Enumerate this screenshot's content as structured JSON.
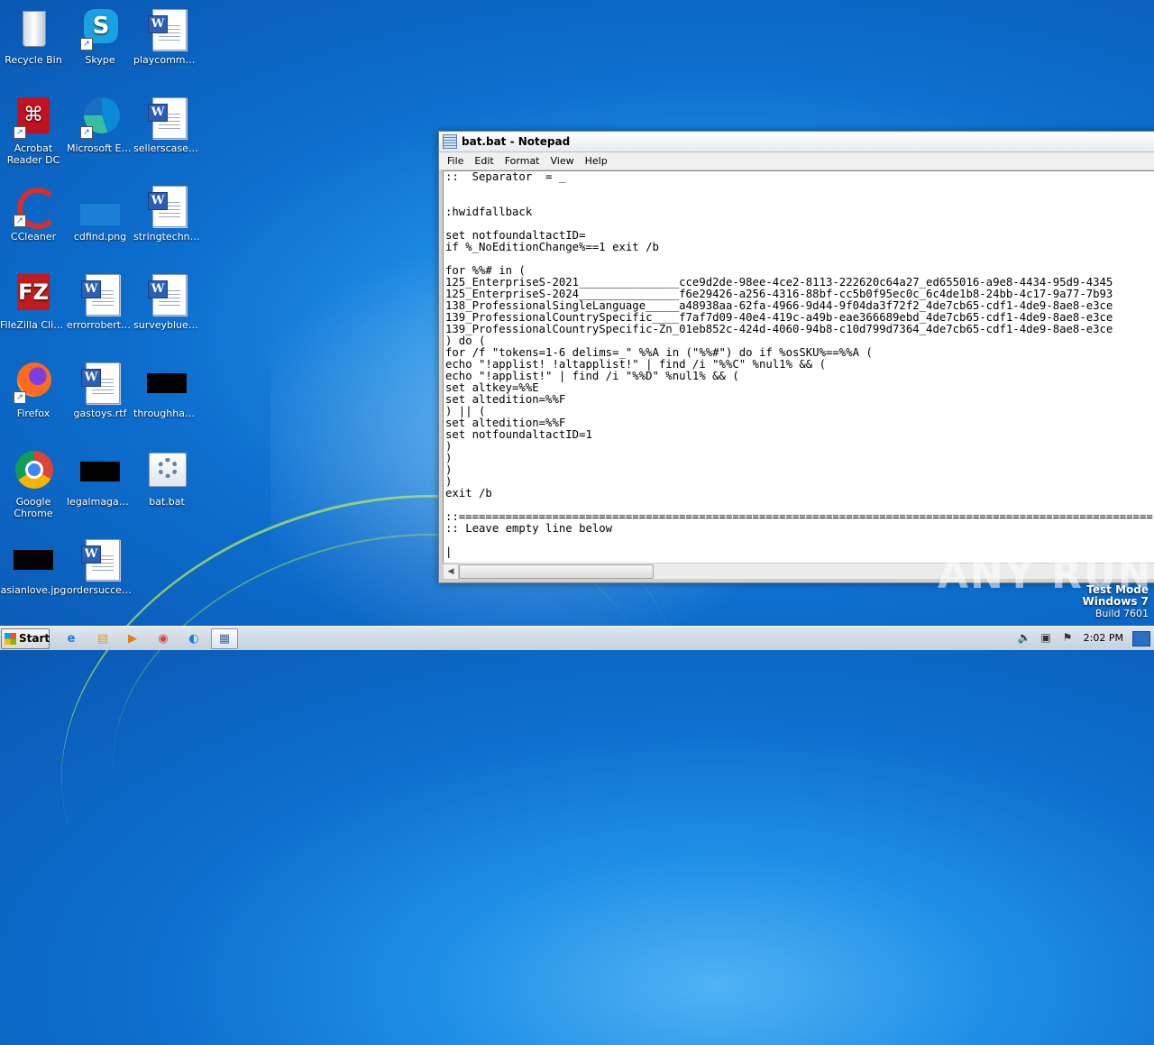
{
  "desktop": {
    "icons": [
      {
        "label": "Recycle Bin",
        "icon": "recycle-bin-icon"
      },
      {
        "label": "Skype",
        "icon": "skype-icon"
      },
      {
        "label": "playcomme...",
        "icon": "word-document-icon"
      },
      {
        "label": "Acrobat Reader DC",
        "icon": "acrobat-icon"
      },
      {
        "label": "Microsoft Edge",
        "icon": "edge-icon"
      },
      {
        "label": "sellerscase.rtf",
        "icon": "word-document-icon"
      },
      {
        "label": "CCleaner",
        "icon": "ccleaner-icon"
      },
      {
        "label": "cdfind.png",
        "icon": "image-file-icon"
      },
      {
        "label": "stringtechni...",
        "icon": "word-document-icon"
      },
      {
        "label": "FileZilla Client",
        "icon": "filezilla-icon"
      },
      {
        "label": "errorrobert.rtf",
        "icon": "word-document-icon"
      },
      {
        "label": "surveyblue.rtf",
        "icon": "word-document-icon"
      },
      {
        "label": "Firefox",
        "icon": "firefox-icon"
      },
      {
        "label": "gastoys.rtf",
        "icon": "word-document-icon"
      },
      {
        "label": "throughhad...",
        "icon": "image-file-icon"
      },
      {
        "label": "Google Chrome",
        "icon": "chrome-icon"
      },
      {
        "label": "legalmagazi...",
        "icon": "image-file-icon"
      },
      {
        "label": "bat.bat",
        "icon": "batch-file-icon"
      },
      {
        "label": "asianlove.jpg",
        "icon": "image-file-icon"
      },
      {
        "label": "ordersuccer...",
        "icon": "word-document-icon"
      }
    ]
  },
  "notepad": {
    "title": "bat.bat - Notepad",
    "menu": [
      "File",
      "Edit",
      "Format",
      "View",
      "Help"
    ],
    "lines": [
      "::  Separator  = _",
      "",
      "",
      ":hwidfallback",
      "",
      "set notfoundaltactID=",
      "if %_NoEditionChange%==1 exit /b",
      "",
      "for %%# in (",
      "125_EnterpriseS-2021_______________cce9d2de-98ee-4ce2-8113-222620c64a27_ed655016-a9e8-4434-95d9-4345",
      "125_EnterpriseS-2024_______________f6e29426-a256-4316-88bf-cc5b0f95ec0c_6c4de1b8-24bb-4c17-9a77-7b93",
      "138_ProfessionalSingleLanguage_____a48938aa-62fa-4966-9d44-9f04da3f72f2_4de7cb65-cdf1-4de9-8ae8-e3ce",
      "139_ProfessionalCountrySpecific____f7af7d09-40e4-419c-a49b-eae366689ebd_4de7cb65-cdf1-4de9-8ae8-e3ce",
      "139_ProfessionalCountrySpecific-Zn_01eb852c-424d-4060-94b8-c10d799d7364_4de7cb65-cdf1-4de9-8ae8-e3ce",
      ") do (",
      "for /f \"tokens=1-6 delims=_\" %%A in (\"%%#\") do if %osSKU%==%%A (",
      "echo \"!applist! !altapplist!\" | find /i \"%%C\" %nul1% && (",
      "echo \"!applist!\" | find /i \"%%D\" %nul1% && (",
      "set altkey=%%E",
      "set altedition=%%F",
      ") || (",
      "set altedition=%%F",
      "set notfoundaltactID=1",
      ")",
      ")",
      ")",
      ")",
      "exit /b",
      "",
      "::========================================================================================================",
      ":: Leave empty line below",
      "",
      "|"
    ]
  },
  "watermark": "ANY RUN",
  "system_notice": {
    "line1": "Test Mode",
    "line2": "Windows 7",
    "line3": "Build 7601"
  },
  "taskbar": {
    "start_label": "Start",
    "clock": "2:02 PM"
  }
}
